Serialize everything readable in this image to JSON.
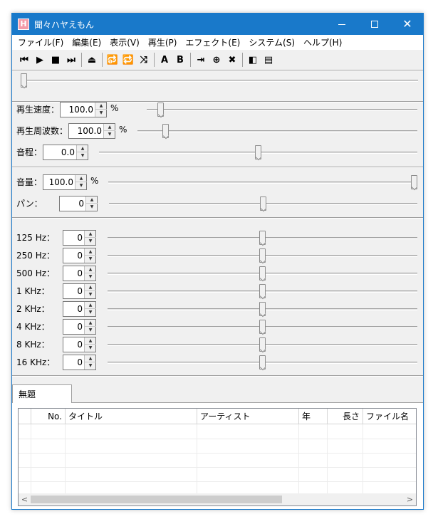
{
  "window": {
    "title": "聞々ハヤえもん",
    "app_icon_glyph": "H",
    "close_glyph": "✕"
  },
  "menu": [
    "ファイル(F)",
    "編集(E)",
    "表示(V)",
    "再生(P)",
    "エフェクト(E)",
    "システム(S)",
    "ヘルプ(H)"
  ],
  "toolbar": {
    "buttons": [
      {
        "name": "previous-track-icon",
        "glyph": "⏮"
      },
      {
        "name": "play-icon",
        "glyph": "▶"
      },
      {
        "name": "stop-icon",
        "glyph": "■"
      },
      {
        "name": "next-track-icon",
        "glyph": "⏭"
      },
      {
        "name": "eject-icon",
        "glyph": "⏏"
      },
      {
        "name": "repeat-one-icon",
        "glyph": "🔂"
      },
      {
        "name": "repeat-all-icon",
        "glyph": "🔁"
      },
      {
        "name": "shuffle-icon",
        "glyph": "⤨"
      },
      {
        "name": "ab-point-a-icon",
        "glyph": "A"
      },
      {
        "name": "ab-point-b-icon",
        "glyph": "B"
      },
      {
        "name": "marker-play-icon",
        "glyph": "⇥"
      },
      {
        "name": "add-marker-icon",
        "glyph": "⊕"
      },
      {
        "name": "delete-marker-icon",
        "glyph": "✖"
      },
      {
        "name": "explorer-view-icon",
        "glyph": "◧"
      },
      {
        "name": "playlist-view-icon",
        "glyph": "▤"
      }
    ]
  },
  "seek": {
    "position": 0.0
  },
  "controls": {
    "speed": {
      "label": "再生速度：",
      "value": "100.0",
      "unit": "%",
      "level": 0.04
    },
    "frequency": {
      "label": "再生周波数：",
      "value": "100.0",
      "unit": "%",
      "level": 0.09
    },
    "pitch": {
      "label": "音程：",
      "value": "0.0",
      "level": 0.5
    },
    "volume": {
      "label": "音量：",
      "value": "100.0",
      "unit": "%",
      "level": 1.0
    },
    "pan": {
      "label": "パン：",
      "value": "0",
      "level": 0.5
    }
  },
  "eq": [
    {
      "label": "125 Hz：",
      "value": "0",
      "level": 0.5
    },
    {
      "label": "250 Hz：",
      "value": "0",
      "level": 0.5
    },
    {
      "label": "500 Hz：",
      "value": "0",
      "level": 0.5
    },
    {
      "label": "1 KHz：",
      "value": "0",
      "level": 0.5
    },
    {
      "label": "2 KHz：",
      "value": "0",
      "level": 0.5
    },
    {
      "label": "4 KHz：",
      "value": "0",
      "level": 0.5
    },
    {
      "label": "8 KHz：",
      "value": "0",
      "level": 0.5
    },
    {
      "label": "16 KHz：",
      "value": "0",
      "level": 0.5
    }
  ],
  "playlist": {
    "tab_label": "無題",
    "columns": [
      "",
      "No.",
      "タイトル",
      "アーティスト",
      "年",
      "長さ",
      "ファイル名"
    ],
    "scroll_left_glyph": "<",
    "scroll_right_glyph": ">"
  },
  "colors": {
    "titlebar": "#1979ca",
    "app_icon": "#f49ba8"
  }
}
